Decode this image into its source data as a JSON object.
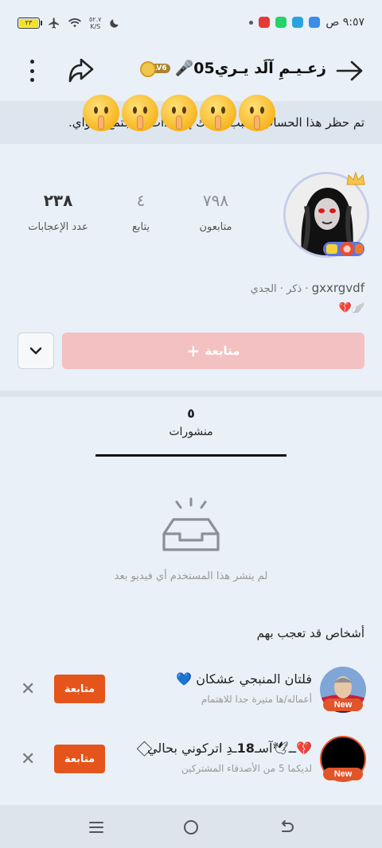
{
  "status_bar": {
    "battery": "٢٣",
    "speed_value": "٥٢.٧",
    "speed_unit": "K/S",
    "time": "٩:٥٧ ص",
    "icons": [
      "moon-icon",
      "wifi-icon",
      "airplane-icon",
      "battery-icon",
      "photos-app-icon",
      "telegram-icon",
      "whatsapp-icon",
      "video-app-icon"
    ]
  },
  "header": {
    "title": "🎤زعـيـمِ آلَد يـري05",
    "level_badge": "LV6"
  },
  "banner": {
    "text": "تم حظر هذا الحساب بسبب انتهاك إرشادات المجتمع أو",
    "text_end": "واي.",
    "emoji": "🤫"
  },
  "profile": {
    "stats": [
      {
        "value": "٧٩٨",
        "label": "متابعون"
      },
      {
        "value": "٤",
        "label": "يتابع"
      },
      {
        "value": "٢٣٨",
        "label": "عدد الإعجابات"
      }
    ],
    "username": "gxxrgvdf",
    "gender": "ذكر",
    "zodiac": "الجدي",
    "bio": "💔🪽",
    "follow_label": "متابعة"
  },
  "posts_tab": {
    "count": "٥",
    "label": "منشورات"
  },
  "empty_state": {
    "text": "لم ينشر هذا المستخدم أي فيديو بعد"
  },
  "suggestions": {
    "title": "أشخاص قد تعجب بهم",
    "items": [
      {
        "name": "فلتان المنبجي عشكان 💙",
        "subtitle": "أعماله/ها متيرة جدا للاهتمام",
        "badge": "New",
        "follow_label": "متابعة"
      },
      {
        "name": "⁦⃟ــ🕊آسـ𝟭𝟴ـدِ اتركوني بحالي💔⁩",
        "subtitle": "لديكما 5 من الأصدقاء المشتركين",
        "badge": "New",
        "follow_label": "متابعة"
      }
    ]
  },
  "colors": {
    "accent": "#e5541b",
    "follow_disabled": "#f3c1c2",
    "background": "#e9f0f7"
  }
}
